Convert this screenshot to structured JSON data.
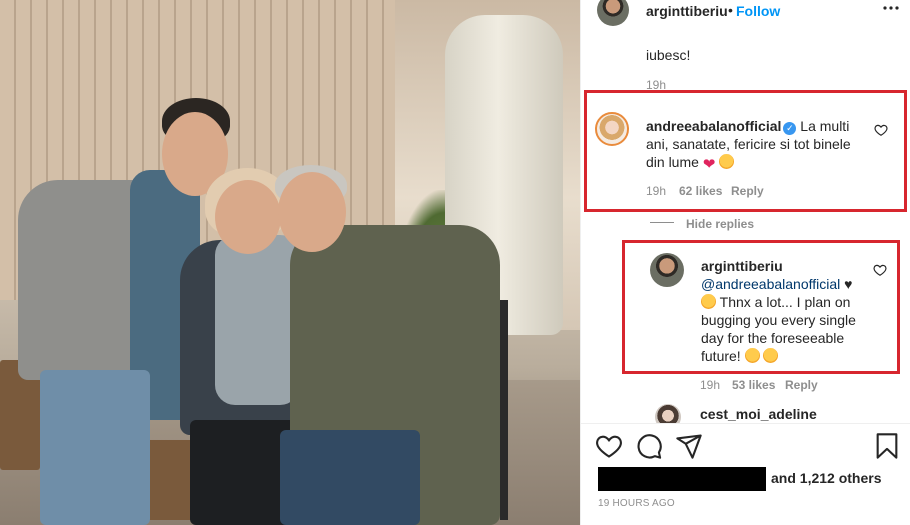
{
  "post": {
    "username": "arginttiberiu",
    "follow_separator": "•",
    "follow_label": "Follow",
    "timestamp": "19 HOURS AGO"
  },
  "comments": {
    "prev_tail_text": "iubesc!",
    "prev_time": "19h",
    "main": {
      "username": "andreeabalanofficial",
      "line1": "La multi",
      "line2": "ani, sanatate, fericire si tot binele",
      "line3": "din lume",
      "time": "19h",
      "likes": "62 likes",
      "reply": "Reply",
      "verified_glyph": "✓",
      "heart_emoji": "❤"
    },
    "hide_replies": "Hide replies",
    "reply": {
      "username": "arginttiberiu",
      "mention": "@andreeabalanofficial",
      "heart_glyph": "♥",
      "line2": "Thnx a lot... I plan on",
      "line3": "bugging you every single",
      "line4": "day for the foreseeable",
      "line5": "future!",
      "time": "19h",
      "likes": "53 likes",
      "reply": "Reply"
    },
    "next": {
      "username": "cest_moi_adeline"
    }
  },
  "likes": {
    "others": "and 1,212 others"
  },
  "icons": [
    "more-icon",
    "heart-icon",
    "comment-icon",
    "share-icon",
    "bookmark-icon",
    "verified-icon"
  ],
  "colors": {
    "highlight_box": "#d7262e",
    "follow_blue": "#0095f6",
    "meta_gray": "#8e8e8e",
    "mention_blue": "#00376b"
  }
}
